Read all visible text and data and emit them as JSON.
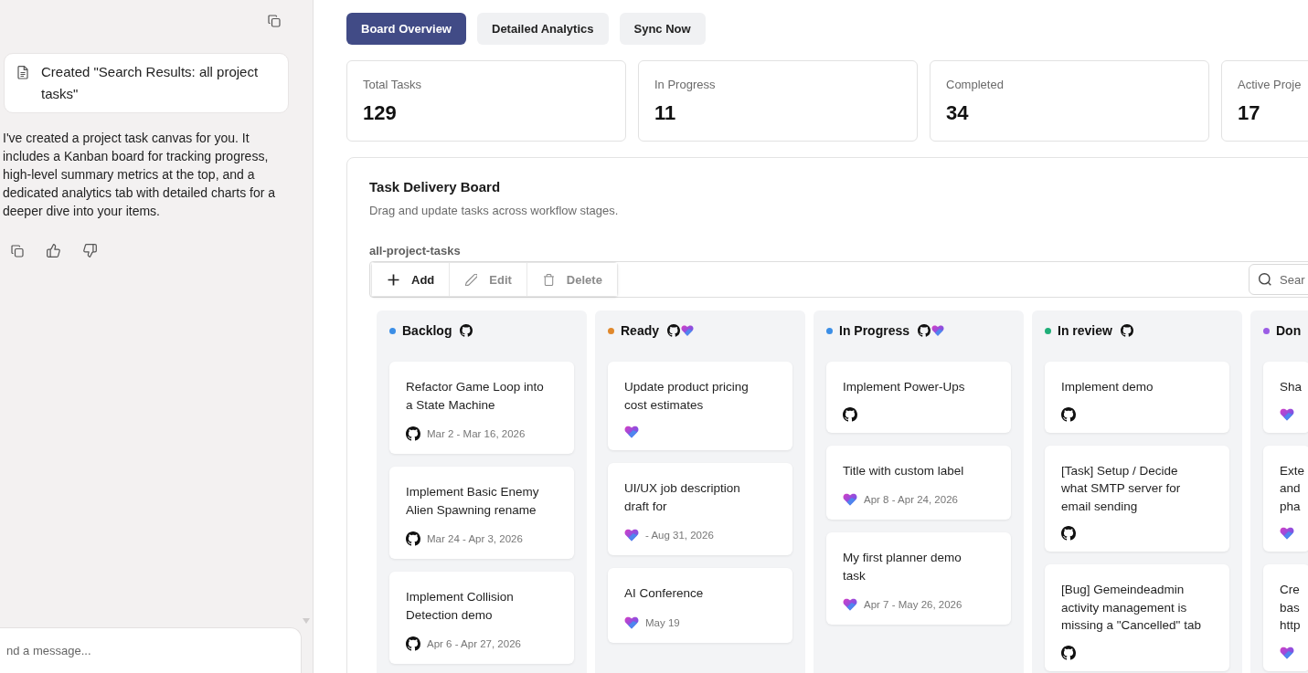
{
  "chat": {
    "artifact": {
      "title": "Created \"Search Results: all project tasks\""
    },
    "message": "I've created a project task canvas for you. It includes a Kanban board for tracking progress, high-level summary metrics at the top, and a dedicated analytics tab with detailed charts for a deeper dive into your items.",
    "input": {
      "placeholder": "nd a message..."
    }
  },
  "tabs": [
    {
      "label": "Board Overview",
      "selected": true
    },
    {
      "label": "Detailed Analytics",
      "selected": false
    }
  ],
  "sync_button": {
    "label": "Sync Now"
  },
  "stats": [
    {
      "label": "Total Tasks",
      "value": "129"
    },
    {
      "label": "In Progress",
      "value": "11"
    },
    {
      "label": "Completed",
      "value": "34"
    },
    {
      "label": "Active Proje",
      "value": "17"
    }
  ],
  "board": {
    "title": "Task Delivery Board",
    "subtitle": "Drag and update tasks across workflow stages.",
    "list_name": "all-project-tasks",
    "toolbar": [
      {
        "kind": "add",
        "label": "Add",
        "disabled": false
      },
      {
        "kind": "edit",
        "label": "Edit",
        "disabled": true
      },
      {
        "kind": "delete",
        "label": "Delete",
        "disabled": true
      }
    ],
    "search": {
      "placeholder": "Sear"
    },
    "columns": [
      {
        "title": "Backlog",
        "color": "#3b8ee6",
        "icons": [
          {
            "kind": "github"
          }
        ],
        "cards": [
          {
            "kind": "github",
            "title": "Refactor Game Loop into a State Machine",
            "dates": "Mar 2 - Mar 16, 2026"
          },
          {
            "kind": "github",
            "title": "Implement Basic Enemy Alien Spawning rename",
            "dates": "Mar 24 - Apr 3, 2026"
          },
          {
            "kind": "github",
            "title": "Implement Collision Detection demo",
            "dates": "Apr 6 - Apr 27, 2026"
          }
        ]
      },
      {
        "title": "Ready",
        "color": "#e0882c",
        "icons": [
          {
            "kind": "github"
          },
          {
            "kind": "planner"
          }
        ],
        "cards": [
          {
            "kind": "planner",
            "title": "Update product pricing cost estimates"
          },
          {
            "kind": "planner",
            "title": "UI/UX job description draft for",
            "dates": "- Aug 31, 2026"
          },
          {
            "kind": "planner",
            "title": "AI Conference",
            "dates": "May 19"
          }
        ]
      },
      {
        "title": "In Progress",
        "color": "#3b8ee6",
        "icons": [
          {
            "kind": "github"
          },
          {
            "kind": "planner"
          }
        ],
        "cards": [
          {
            "kind": "github",
            "title": "Implement Power-Ups"
          },
          {
            "kind": "planner",
            "title": "Title with custom label",
            "dates": "Apr 8 - Apr 24, 2026"
          },
          {
            "kind": "planner",
            "title": "My first planner demo task",
            "dates": "Apr 7 - May 26, 2026"
          }
        ]
      },
      {
        "title": "In review",
        "color": "#1fae78",
        "icons": [
          {
            "kind": "github"
          }
        ],
        "cards": [
          {
            "kind": "github",
            "title": "Implement demo"
          },
          {
            "kind": "github",
            "title": "[Task] Setup / Decide what SMTP server for email sending"
          },
          {
            "kind": "github",
            "title": "[Bug] Gemeindeadmin activity management is missing a \"Cancelled\" tab"
          }
        ]
      },
      {
        "title": "Don",
        "color": "#9b5de5",
        "cards": [
          {
            "kind": "planner",
            "title": "Sha"
          },
          {
            "kind": "planner",
            "title": "Exte and pha"
          },
          {
            "kind": "planner",
            "title": "Cre bas http"
          }
        ]
      }
    ]
  }
}
